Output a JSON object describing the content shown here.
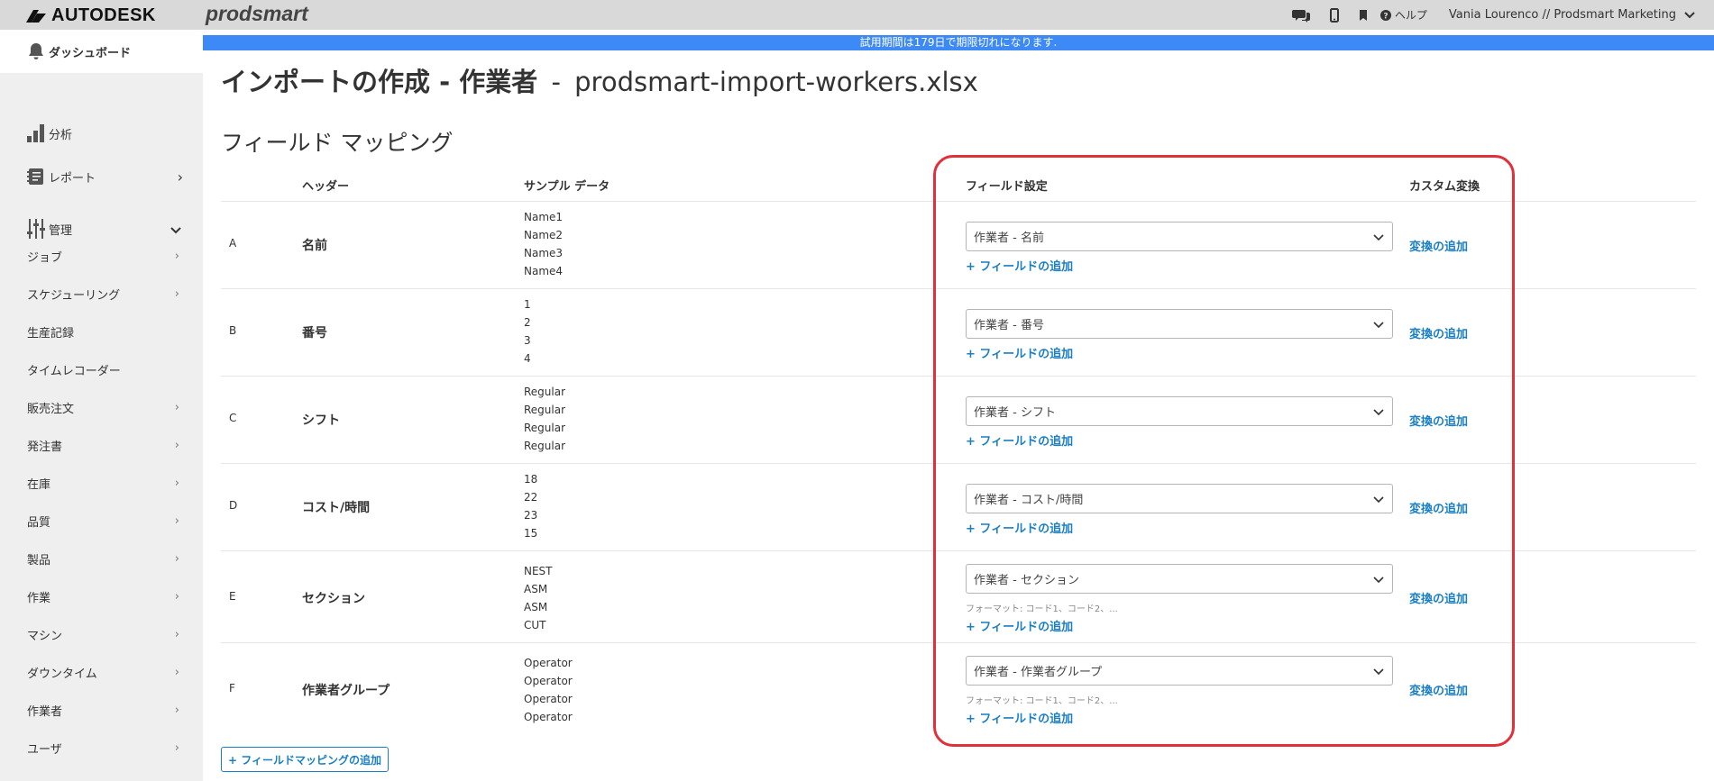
{
  "topbar": {
    "brand": "AUTODESK",
    "product": "prodsmart",
    "help_label": "ヘルプ",
    "user_label": "Vania Lourenco // Prodsmart Marketing"
  },
  "banner": {
    "text": "試用期間は179日で期限切れになります."
  },
  "sidebar": {
    "items": [
      {
        "label": "ダッシュボード"
      },
      {
        "label": "分析"
      },
      {
        "label": "レポート"
      },
      {
        "label": "管理"
      },
      {
        "label": "ジョブ"
      },
      {
        "label": "スケジューリング"
      },
      {
        "label": "生産記録"
      },
      {
        "label": "タイムレコーダー"
      },
      {
        "label": "販売注文"
      },
      {
        "label": "発注書"
      },
      {
        "label": "在庫"
      },
      {
        "label": "品質"
      },
      {
        "label": "製品"
      },
      {
        "label": "作業"
      },
      {
        "label": "マシン"
      },
      {
        "label": "ダウンタイム"
      },
      {
        "label": "作業者"
      },
      {
        "label": "ユーザ"
      }
    ]
  },
  "page": {
    "title_main": "インポートの作成 - 作業者",
    "title_dash": "-",
    "title_file": "prodsmart-import-workers.xlsx",
    "section_title": "フィールド マッピング"
  },
  "table": {
    "headers": {
      "header": "ヘッダー",
      "sample": "サンプル データ",
      "field": "フィールド設定",
      "custom": "カスタム変換"
    },
    "add_field_label": "+ フィールドの追加",
    "transform_label": "変換の追加",
    "rows": [
      {
        "letter": "A",
        "header": "名前",
        "samples": [
          "Name1",
          "Name2",
          "Name3",
          "Name4"
        ],
        "field": "作業者 - 名前",
        "format": ""
      },
      {
        "letter": "B",
        "header": "番号",
        "samples": [
          "1",
          "2",
          "3",
          "4"
        ],
        "field": "作業者 - 番号",
        "format": ""
      },
      {
        "letter": "C",
        "header": "シフト",
        "samples": [
          "Regular",
          "Regular",
          "Regular",
          "Regular"
        ],
        "field": "作業者 - シフト",
        "format": ""
      },
      {
        "letter": "D",
        "header": "コスト/時間",
        "samples": [
          "18",
          "22",
          "23",
          "15"
        ],
        "field": "作業者 - コスト/時間",
        "format": ""
      },
      {
        "letter": "E",
        "header": "セクション",
        "samples": [
          "NEST",
          "ASM",
          "ASM",
          "CUT"
        ],
        "field": "作業者 - セクション",
        "format": "フォーマット: コード1、コード2、..."
      },
      {
        "letter": "F",
        "header": "作業者グループ",
        "samples": [
          "Operator",
          "Operator",
          "Operator",
          "Operator"
        ],
        "field": "作業者 - 作業者グループ",
        "format": "フォーマット: コード1、コード2、..."
      }
    ]
  },
  "add_mapping_label": "+ フィールドマッピングの追加"
}
